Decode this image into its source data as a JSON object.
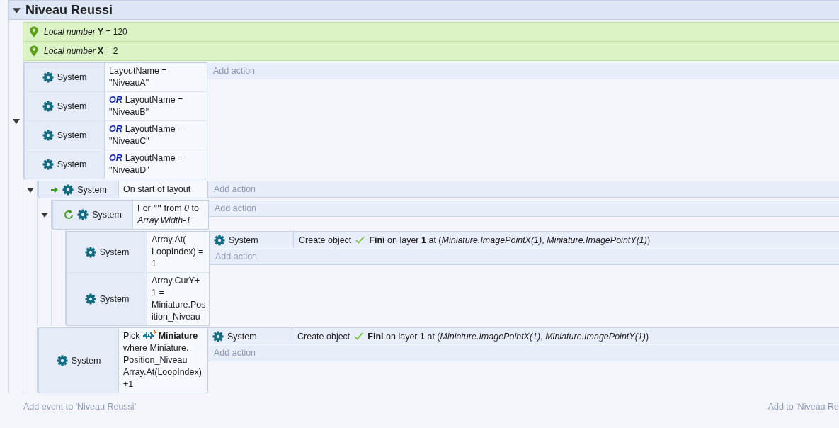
{
  "group": {
    "title": "Niveau Reussi",
    "expanded": true
  },
  "locals": [
    {
      "text": "*Local number* **Y** = 120"
    },
    {
      "text": "*Local number* **X** = 2"
    }
  ],
  "events": [
    {
      "expanded": true,
      "conditions": [
        {
          "kind": "plain",
          "object": "System",
          "text": "LayoutName = \"NiveauA\""
        },
        {
          "kind": "or",
          "object": "System",
          "prefix": "OR",
          "text": "LayoutName = \"NiveauB\""
        },
        {
          "kind": "or",
          "object": "System",
          "prefix": "OR",
          "text": "LayoutName = \"NiveauC\""
        },
        {
          "kind": "or",
          "object": "System",
          "prefix": "OR",
          "text": "LayoutName = \"NiveauD\""
        }
      ],
      "add_action": "Add action",
      "children": [
        {
          "kind": "trigger",
          "expanded": true,
          "conditions": [
            {
              "kind": "plain",
              "object": "System",
              "text": "On start of layout"
            }
          ],
          "add_action": "Add action",
          "children": [
            {
              "kind": "loop",
              "expanded": true,
              "conditions": [
                {
                  "kind": "plain",
                  "object": "System",
                  "text": "For **\"\"** from *0* to *Array.Width-1*"
                }
              ],
              "add_action": "Add action",
              "children": [
                {
                  "conditions": [
                    {
                      "kind": "plain",
                      "object": "System",
                      "text": "Array.At( LoopIndex) = 1"
                    },
                    {
                      "kind": "plain",
                      "object": "System",
                      "text": "Array.CurY+ 1 = Miniature.Position_Niveau"
                    }
                  ],
                  "actions": [
                    {
                      "object": "System",
                      "verb": "Create object",
                      "text": "**Fini** on layer **1** at (*Miniature.ImagePointX(1)*, *Miniature.ImagePointY(1)*)"
                    }
                  ],
                  "add_action": "Add action"
                }
              ]
            }
          ]
        },
        {
          "conditions": [
            {
              "kind": "pick",
              "object": "System",
              "prefix": "Pick",
              "text": "**Miniature** where Miniature. Position_Niveau = Array.At(LoopIndex) +1"
            }
          ],
          "actions": [
            {
              "object": "System",
              "verb": "Create object",
              "text": "**Fini** on layer **1** at (*Miniature.ImagePointX(1)*, *Miniature.ImagePointY(1)*)"
            }
          ],
          "add_action": "Add action"
        }
      ]
    }
  ],
  "footer": {
    "add_event": "Add event to 'Niveau Reussi'",
    "add_to": "Add to 'Niveau Re"
  }
}
